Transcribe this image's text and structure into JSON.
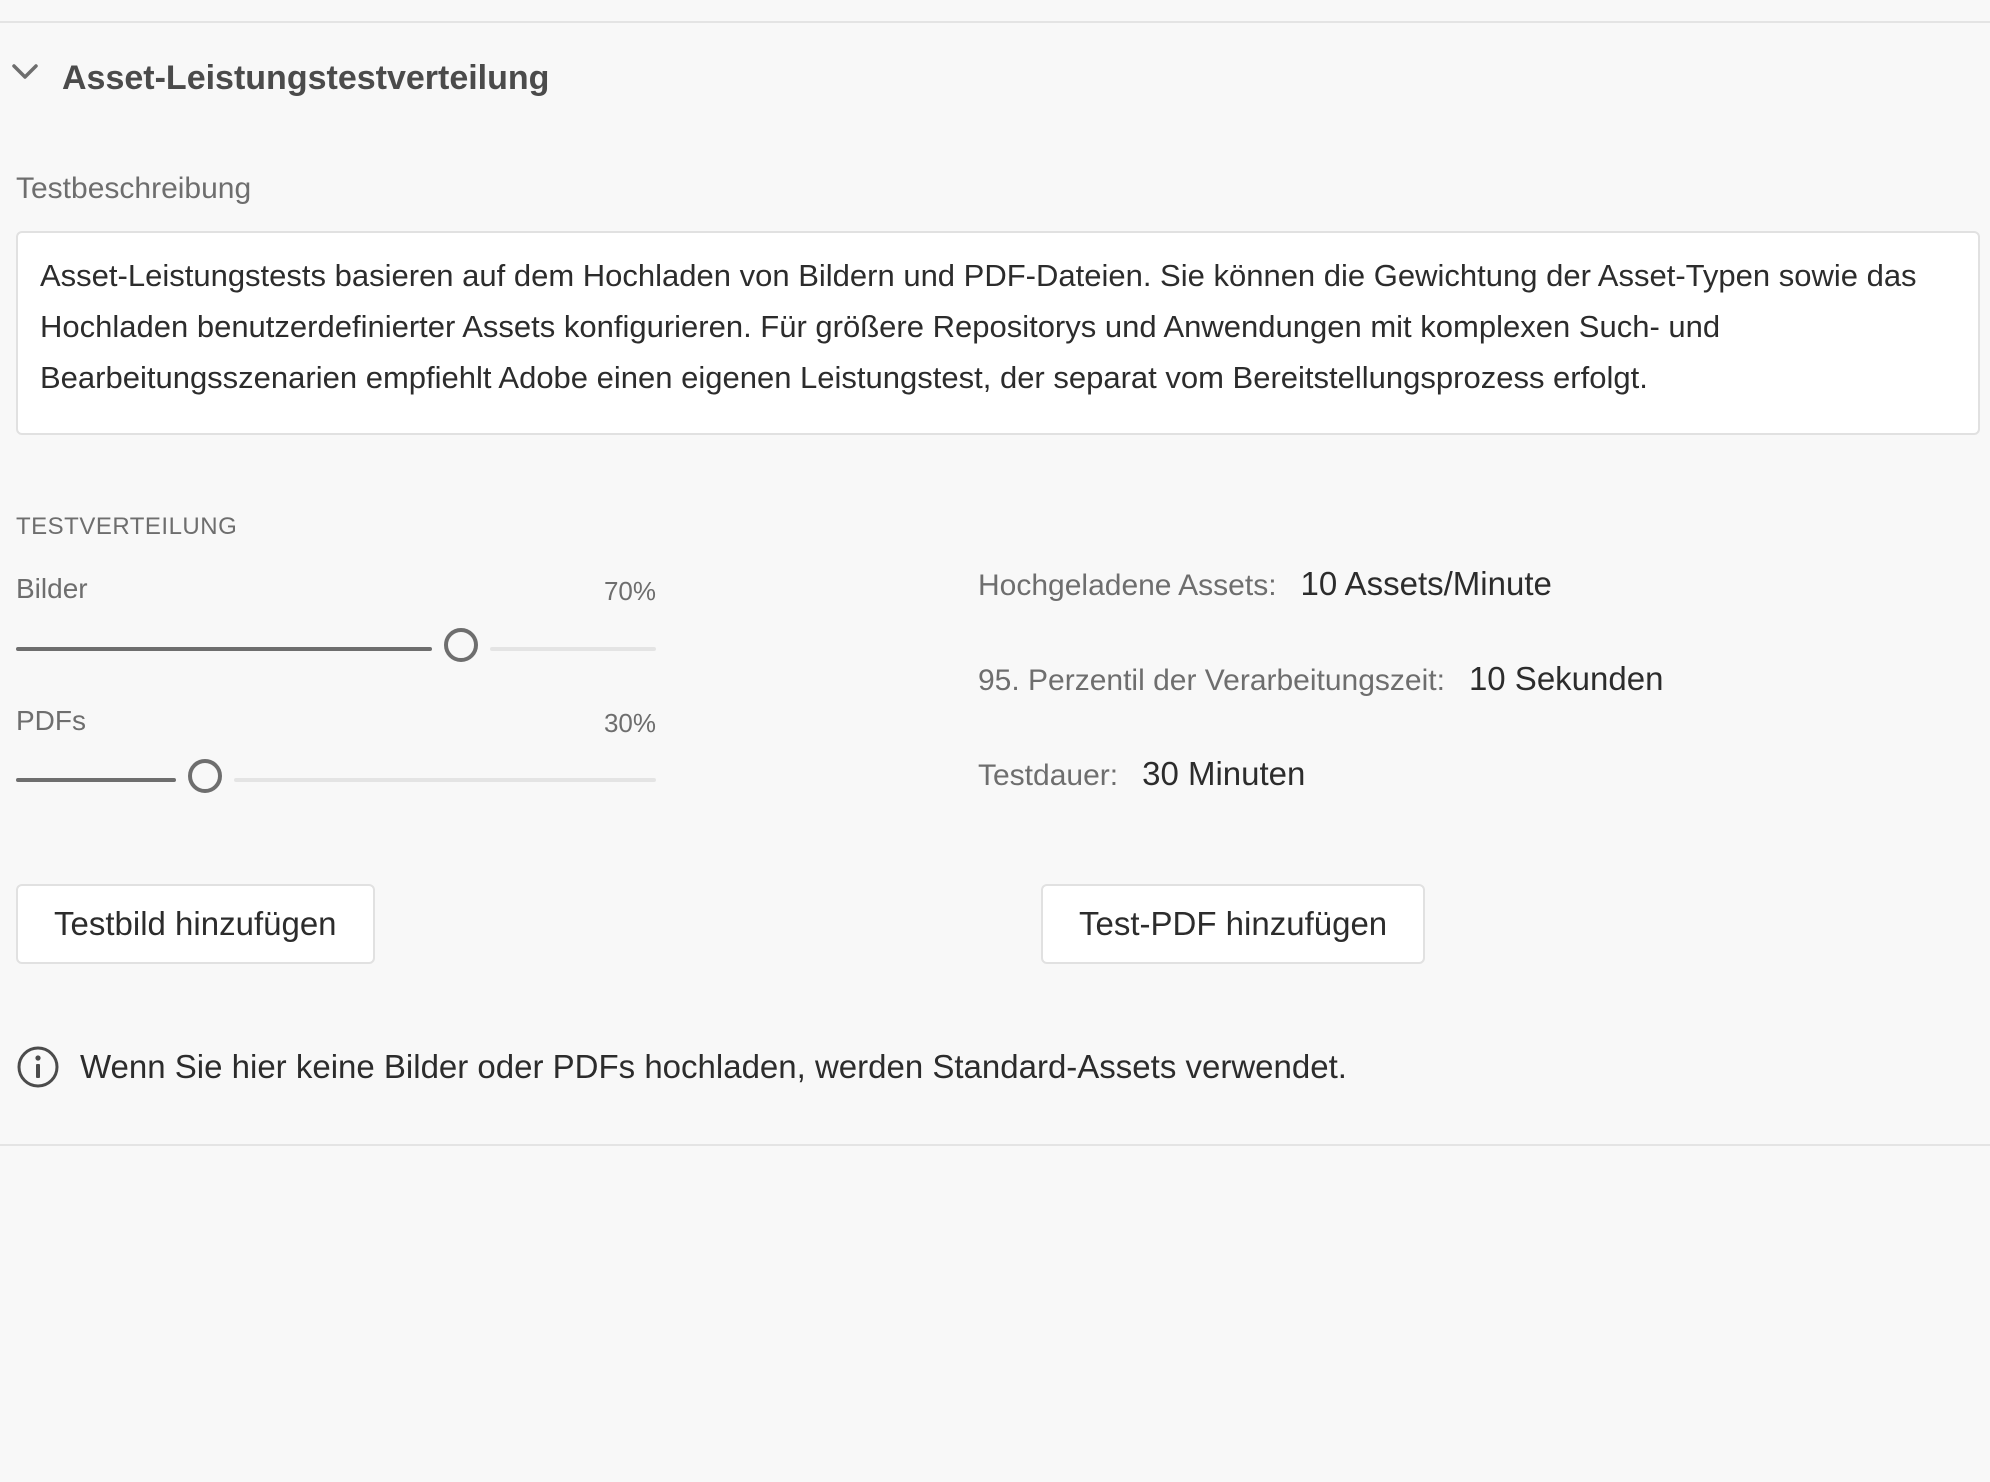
{
  "section": {
    "title": "Asset-Leistungstestverteilung",
    "description_label": "Testbeschreibung",
    "description": "Asset-Leistungstests basieren auf dem Hochladen von Bildern und PDF-Dateien. Sie können die Gewichtung der Asset-Typen sowie das Hochladen benutzerdefinierter Assets konfigurieren. Für größere Repositorys und Anwendungen mit komplexen Such- und Bearbeitungsszenarien empfiehlt Adobe einen eigenen Leistungstest, der separat vom Bereitstellungsprozess erfolgt."
  },
  "distribution": {
    "heading": "TESTVERTEILUNG",
    "images": {
      "label": "Bilder",
      "value_text": "70%",
      "fraction": 0.7
    },
    "pdfs": {
      "label": "PDFs",
      "value_text": "30%",
      "fraction": 0.3
    }
  },
  "stats": {
    "uploaded": {
      "label": "Hochgeladene Assets:",
      "value": "10 Assets/Minute"
    },
    "percentile": {
      "label": "95. Perzentil der Verarbeitungszeit:",
      "value": "10 Sekunden"
    },
    "duration": {
      "label": "Testdauer:",
      "value": "30 Minuten"
    }
  },
  "buttons": {
    "add_image": "Testbild hinzufügen",
    "add_pdf": "Test-PDF hinzufügen"
  },
  "info": {
    "icon": "info-icon",
    "text": "Wenn Sie hier keine Bilder oder PDFs hochladen, werden Standard-Assets verwendet."
  }
}
